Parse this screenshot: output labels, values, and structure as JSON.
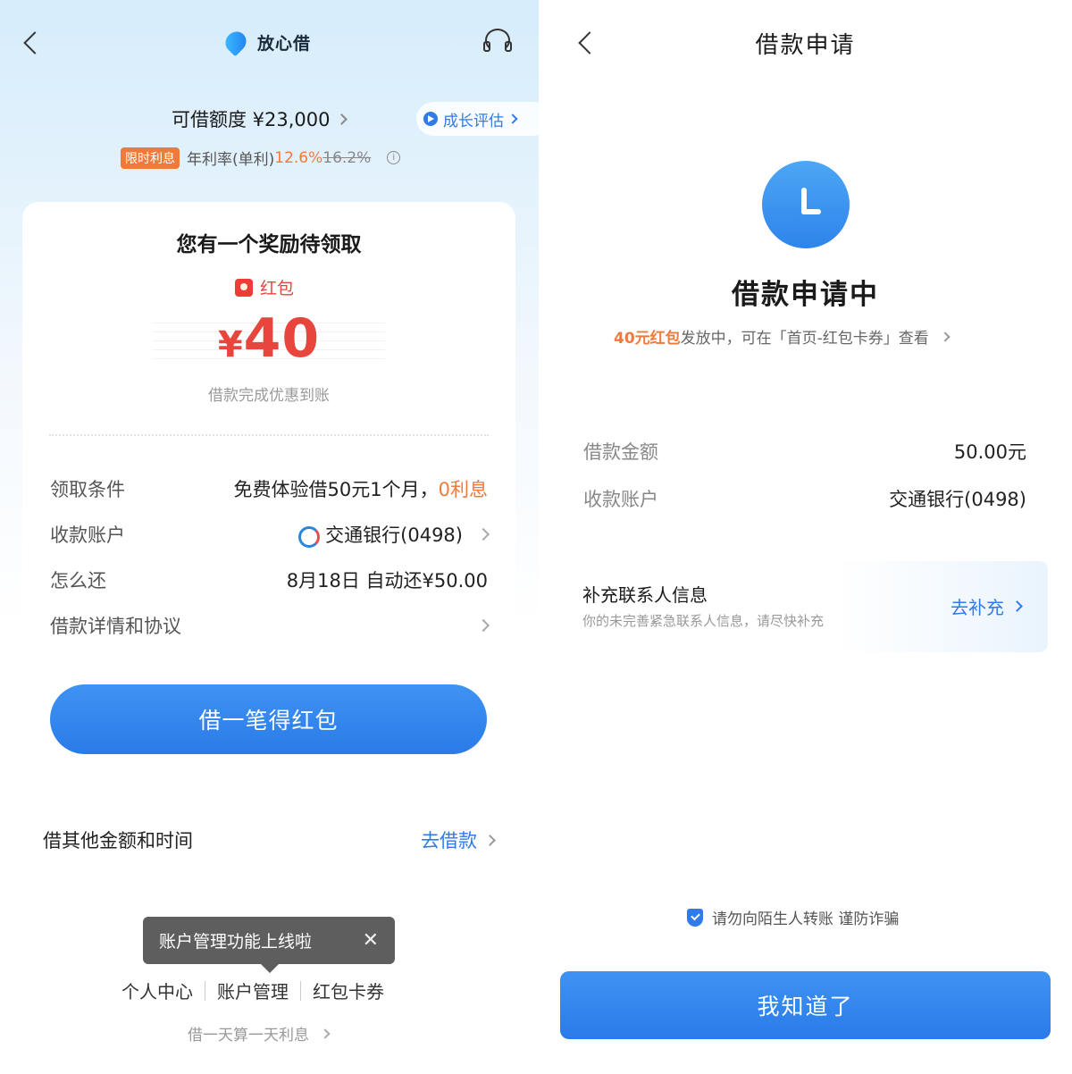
{
  "left": {
    "brand_name": "放心借",
    "limit_label": "可借额度 ¥23,000",
    "growth_label": "成长评估",
    "rate": {
      "badge": "限时利息",
      "label": "年利率(单利)",
      "new_value": "12.6%",
      "old_value": "16.2%"
    },
    "reward": {
      "title": "您有一个奖励待领取",
      "tag": "红包",
      "currency": "¥",
      "amount": "40",
      "subtitle": "借款完成优惠到账"
    },
    "rows": [
      {
        "key": "领取条件",
        "value": "免费体验借50元1个月，",
        "highlight": "0利息"
      },
      {
        "key": "收款账户",
        "value": "交通银行(0498)"
      },
      {
        "key": "怎么还",
        "value": "8月18日 自动还¥50.00"
      },
      {
        "key": "借款详情和协议",
        "value": ""
      }
    ],
    "cta_label": "借一笔得红包",
    "other": {
      "label": "借其他金额和时间",
      "action": "去借款"
    },
    "toast": {
      "text": "账户管理功能上线啦",
      "close": "✕"
    },
    "bottom_nav": [
      "个人中心",
      "账户管理",
      "红包卡券"
    ],
    "bottom_footer": "借一天算一天利息"
  },
  "right": {
    "title": "借款申请",
    "status": "借款申请中",
    "note": {
      "highlight": "40元红包",
      "text": "发放中，可在「首页-红包卡券」查看"
    },
    "rows": [
      {
        "key": "借款金额",
        "value": "50.00元"
      },
      {
        "key": "收款账户",
        "value": "交通银行(0498)"
      }
    ],
    "contact": {
      "title": "补充联系人信息",
      "subtitle": "你的未完善紧急联系人信息，请尽快补充",
      "action": "去补充"
    },
    "safety": "请勿向陌生人转账 谨防诈骗",
    "ok_label": "我知道了"
  },
  "icons": {
    "back": "chevron-left-icon",
    "support": "headset-icon",
    "status": "clock-icon",
    "safety": "shield-icon"
  },
  "colors": {
    "primary": "#2f7bea",
    "accent": "#f07a3c",
    "red": "#e8463d"
  }
}
